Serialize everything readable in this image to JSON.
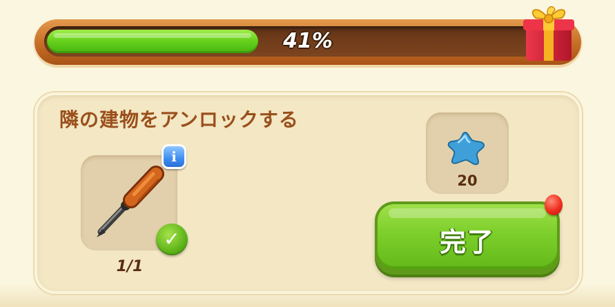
{
  "progress": {
    "value": 0.41,
    "label": "41%"
  },
  "gift": {
    "icon": "gift-box-icon"
  },
  "task": {
    "title": "隣の建物をアンロックする",
    "required_item": {
      "icon": "screwdriver-icon",
      "info_label": "i",
      "count": "1/1",
      "completed": true
    },
    "reward": {
      "icon": "blue-star-icon",
      "amount": "20"
    },
    "complete_button": {
      "label": "完了",
      "has_notification": true
    }
  },
  "colors": {
    "progress_fill": "#68d21c",
    "progress_frame": "#c66d25",
    "title_text": "#9a4f1b",
    "complete_button": "#7dcf2a",
    "notification": "#ee2d1c",
    "info_button": "#3f8df0"
  }
}
